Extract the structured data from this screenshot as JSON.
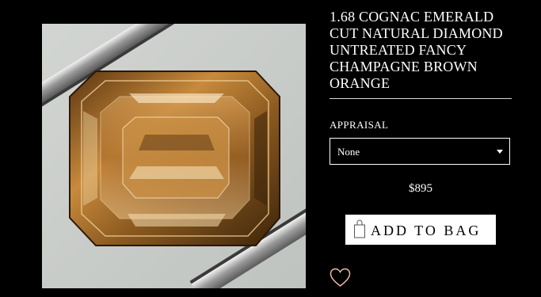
{
  "product": {
    "title": "1.68 COGNAC EMERALD CUT NATURAL DIAMOND UNTREATED FANCY CHAMPAGNE BROWN ORANGE",
    "price": "$895",
    "image_icon": "diamond-in-tweezers-photo"
  },
  "appraisal": {
    "label": "APPRAISAL",
    "selected": "None"
  },
  "actions": {
    "add_to_bag_label": "ADD TO BAG",
    "bag_icon": "shopping-bag-icon",
    "favorite_icon": "heart-icon"
  },
  "colors": {
    "background": "#000000",
    "text": "#ffffff",
    "button_bg": "#ffffff",
    "heart": "#e9b9a8"
  }
}
